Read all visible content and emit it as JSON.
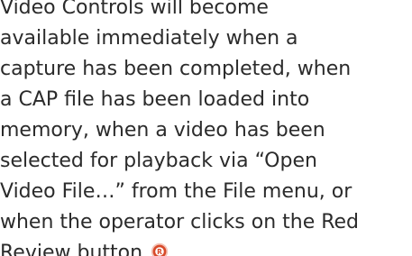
{
  "paragraph": {
    "lines": [
      "Video Controls will become",
      "available immediately when a",
      "capture has been completed, when",
      "a CAP file has been loaded into",
      "memory, when a video has been",
      "selected for playback via “Open",
      "Video File…” from the File menu, or",
      "when the operator clicks on the Red"
    ],
    "last_line_before_icon": "Review button",
    "last_line_after_icon": "."
  },
  "icons": {
    "review_button_icon": "red-review-button-icon",
    "review_button_color": "#d84a2a"
  }
}
